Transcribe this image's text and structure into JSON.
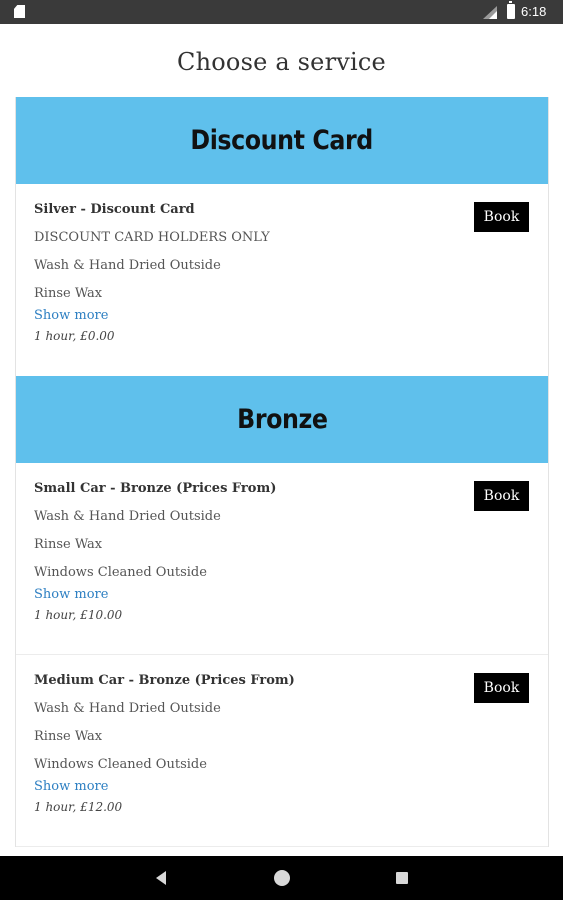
{
  "status_bar": {
    "time": "6:18"
  },
  "page": {
    "title": "Choose a service"
  },
  "categories": [
    {
      "title": "Discount Card",
      "services": [
        {
          "name": "Silver - Discount Card",
          "lines": [
            "DISCOUNT CARD HOLDERS ONLY",
            "Wash & Hand Dried Outside",
            "Rinse Wax"
          ],
          "show_more": "Show more",
          "meta": "1 hour, £0.00",
          "book_label": "Book"
        }
      ]
    },
    {
      "title": "Bronze",
      "services": [
        {
          "name": "Small Car - Bronze (Prices From)",
          "lines": [
            "Wash & Hand Dried Outside",
            "Rinse Wax",
            "Windows Cleaned Outside"
          ],
          "show_more": "Show more",
          "meta": "1 hour, £10.00",
          "book_label": "Book"
        },
        {
          "name": "Medium Car - Bronze (Prices From)",
          "lines": [
            "Wash & Hand Dried Outside",
            "Rinse Wax",
            "Windows Cleaned Outside"
          ],
          "show_more": "Show more",
          "meta": "1 hour, £12.00",
          "book_label": "Book"
        }
      ]
    }
  ],
  "icons": {
    "status_left": "sd-card-icon",
    "signal": "signal-icon",
    "battery": "battery-icon",
    "nav_back": "back-icon",
    "nav_home": "home-icon",
    "nav_recent": "recent-apps-icon"
  },
  "colors": {
    "category_header_bg": "#5fc0ec",
    "book_button_bg": "#000000",
    "link": "#2d7fc2"
  }
}
